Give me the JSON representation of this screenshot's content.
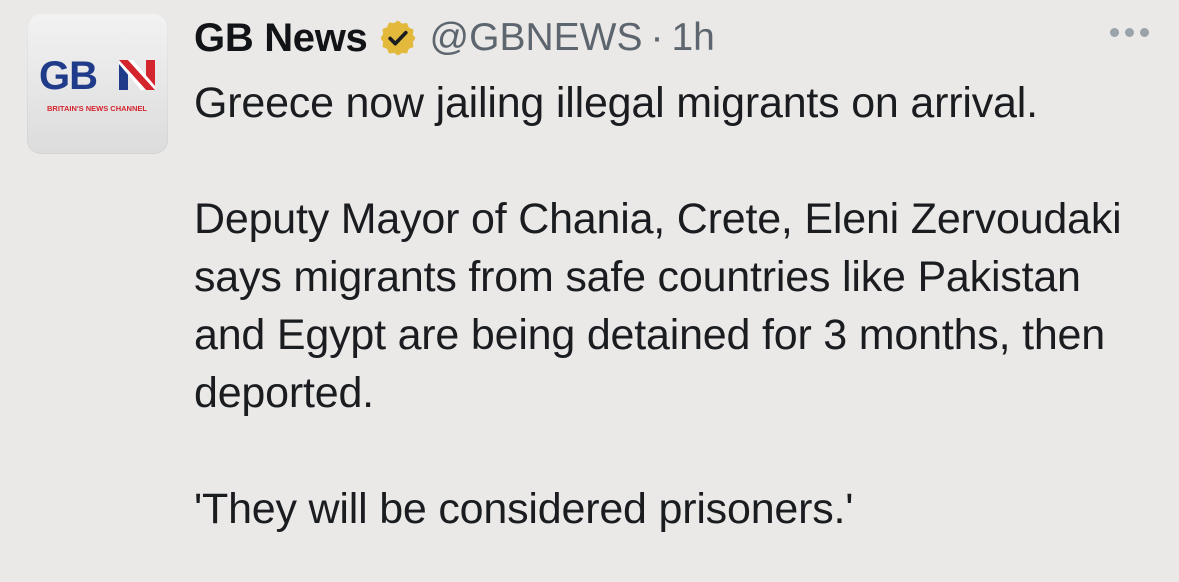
{
  "author": {
    "display_name": "GB News",
    "handle": "@GBNEWS",
    "separator": "·",
    "timestamp": "1h",
    "avatar": {
      "logo_text": "GBN",
      "tagline": "BRITAIN'S NEWS CHANNEL",
      "brand_blue": "#1f3b8a",
      "brand_red": "#d4242d"
    },
    "verified_badge_color": "#e2b93b"
  },
  "tweet": {
    "paragraphs": [
      "Greece now jailing illegal migrants on arrival.",
      "Deputy Mayor of Chania, Crete, Eleni Zervoudaki says migrants from safe countries like Pakistan and Egypt are being detained for 3 months, then deported.",
      "'They will be considered prisoners.'"
    ]
  },
  "icons": {
    "verified": "verified-badge-icon",
    "more": "more-options-icon"
  }
}
